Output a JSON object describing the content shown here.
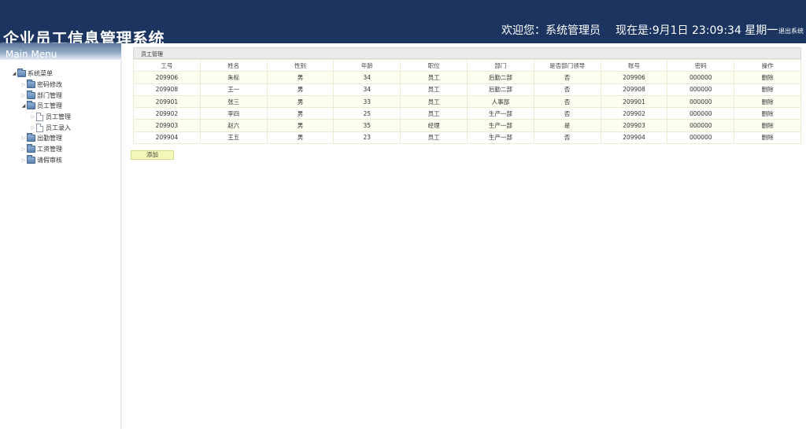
{
  "header": {
    "title": "企业员工信息管理系统",
    "welcome": "欢迎您：系统管理员",
    "datetime": "现在是:9月1日 23:09:34 星期一",
    "logout": "退出系统"
  },
  "sidebar": {
    "menu_title": "Main Menu",
    "tree": [
      {
        "label": "系统菜单",
        "level": 0,
        "expanded": true,
        "icon": "folder-icon"
      },
      {
        "label": "密码修改",
        "level": 1,
        "expanded": false,
        "icon": "folder-icon"
      },
      {
        "label": "部门管理",
        "level": 1,
        "expanded": false,
        "icon": "folder-icon"
      },
      {
        "label": "员工管理",
        "level": 1,
        "expanded": true,
        "icon": "folder-icon"
      },
      {
        "label": "员工管理",
        "level": 2,
        "expanded": false,
        "icon": "file-icon"
      },
      {
        "label": "员工录入",
        "level": 2,
        "expanded": false,
        "icon": "file-icon"
      },
      {
        "label": "出勤管理",
        "level": 1,
        "expanded": false,
        "icon": "folder-icon"
      },
      {
        "label": "工资管理",
        "level": 1,
        "expanded": false,
        "icon": "folder-icon"
      },
      {
        "label": "请假审核",
        "level": 1,
        "expanded": false,
        "icon": "folder-icon"
      }
    ]
  },
  "main": {
    "panel_title": "员工管理",
    "columns": [
      "工号",
      "姓名",
      "性别",
      "年龄",
      "职位",
      "部门",
      "是否部门领导",
      "账号",
      "密码",
      "操作"
    ],
    "rows": [
      [
        "209906",
        "朱标",
        "男",
        "34",
        "员工",
        "后勤二部",
        "否",
        "209906",
        "000000",
        "删除"
      ],
      [
        "209908",
        "王一",
        "男",
        "34",
        "员工",
        "后勤二部",
        "否",
        "209908",
        "000000",
        "删除"
      ],
      [
        "209901",
        "张三",
        "男",
        "33",
        "员工",
        "人事部",
        "否",
        "209901",
        "000000",
        "删除"
      ],
      [
        "209902",
        "李四",
        "男",
        "25",
        "员工",
        "生产一部",
        "否",
        "209902",
        "000000",
        "删除"
      ],
      [
        "209903",
        "赵六",
        "男",
        "35",
        "经理",
        "生产一部",
        "是",
        "209903",
        "000000",
        "删除"
      ],
      [
        "209904",
        "王五",
        "男",
        "23",
        "员工",
        "生产一部",
        "否",
        "209904",
        "000000",
        "删除"
      ]
    ],
    "add_label": "添加"
  }
}
